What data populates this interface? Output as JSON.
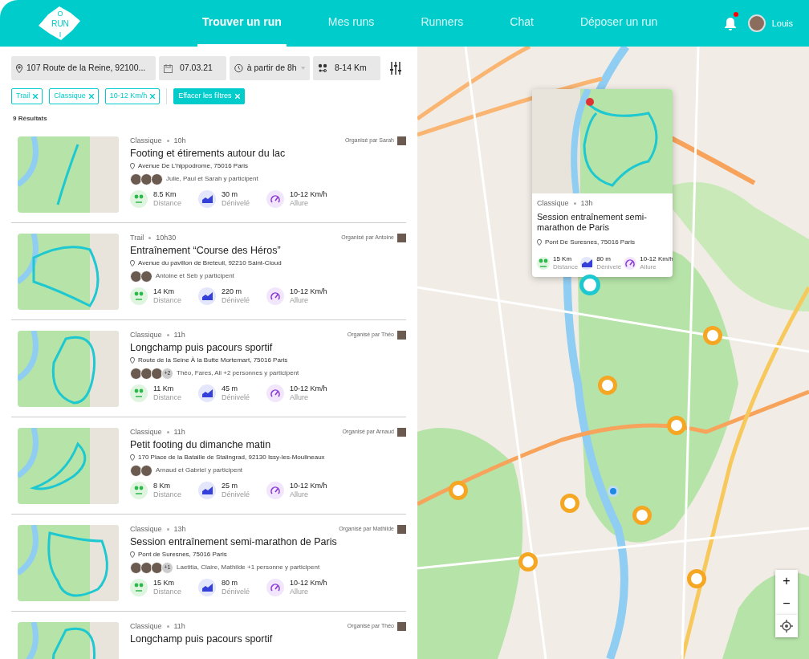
{
  "logo": {
    "top": "O",
    "middle": "RUN",
    "bottom": "I"
  },
  "nav": [
    {
      "label": "Trouver un run",
      "selected": true
    },
    {
      "label": "Mes runs",
      "selected": false
    },
    {
      "label": "Runners",
      "selected": false
    },
    {
      "label": "Chat",
      "selected": false
    },
    {
      "label": "Déposer un run",
      "selected": false
    }
  ],
  "notifications": {
    "unread": true
  },
  "user": {
    "name": "Louis"
  },
  "filters": {
    "location": "107 Route de la Reine, 92100...",
    "date": "07.03.21",
    "time": "à partir de 8h",
    "distance": "8-14 Km"
  },
  "chips": [
    {
      "label": "Trail"
    },
    {
      "label": "Classique"
    },
    {
      "label": "10-12 Km/h"
    }
  ],
  "clear_filters": "Effacer les filtres",
  "results_count": "9 Résultats",
  "runs": [
    {
      "type": "Classique",
      "time": "10h",
      "title": "Footing et étirements autour du lac",
      "organizer": "Organisé par Sarah",
      "address": "Avenue De L'hippodrome, 75016 Paris",
      "avatars": [
        {
          "kind": "photo"
        },
        {
          "kind": "photo"
        },
        {
          "kind": "photo"
        }
      ],
      "participants": "Julie, Paul et Sarah y participent",
      "stats": [
        {
          "kind": "distance",
          "value": "8.5 Km",
          "label": "Distance"
        },
        {
          "kind": "elevation",
          "value": "30 m",
          "label": "Dénivelé"
        },
        {
          "kind": "pace",
          "value": "10-12 Km/h",
          "label": "Allure"
        }
      ]
    },
    {
      "type": "Trail",
      "time": "10h30",
      "title": "Entraînement “Course des Héros”",
      "organizer": "Organisé par Antoine",
      "address": "Avenue du pavillon de Breteuil, 92210 Saint-Cloud",
      "avatars": [
        {
          "kind": "photo"
        },
        {
          "kind": "photo"
        }
      ],
      "participants": "Antoine et Seb y participent",
      "stats": [
        {
          "kind": "distance",
          "value": "14 Km",
          "label": "Distance"
        },
        {
          "kind": "elevation",
          "value": "220 m",
          "label": "Dénivelé"
        },
        {
          "kind": "pace",
          "value": "10-12 Km/h",
          "label": "Allure"
        }
      ]
    },
    {
      "type": "Classique",
      "time": "11h",
      "title": "Longchamp puis pacours sportif",
      "organizer": "Organisé par Théo",
      "address": "Route de la Seine À la Butte Mortemart, 75016 Paris",
      "avatars": [
        {
          "kind": "photo"
        },
        {
          "kind": "photo"
        },
        {
          "kind": "photo"
        },
        {
          "kind": "more",
          "label": "+2"
        }
      ],
      "participants": "Théo, Fares, Ali +2 personnes y participent",
      "stats": [
        {
          "kind": "distance",
          "value": "11 Km",
          "label": "Distance"
        },
        {
          "kind": "elevation",
          "value": "45 m",
          "label": "Dénivelé"
        },
        {
          "kind": "pace",
          "value": "10-12 Km/h",
          "label": "Allure"
        }
      ]
    },
    {
      "type": "Classique",
      "time": "11h",
      "title": "Petit footing du dimanche matin",
      "organizer": "Organisé par Arnaud",
      "address": "170 Place de la Bataille de Stalingrad, 92130 Issy-les-Moulineaux",
      "avatars": [
        {
          "kind": "photo"
        },
        {
          "kind": "photo"
        }
      ],
      "participants": "Arnaud et Gabriel y participent",
      "stats": [
        {
          "kind": "distance",
          "value": "8 Km",
          "label": "Distance"
        },
        {
          "kind": "elevation",
          "value": "25 m",
          "label": "Dénivelé"
        },
        {
          "kind": "pace",
          "value": "10-12 Km/h",
          "label": "Allure"
        }
      ]
    },
    {
      "type": "Classique",
      "time": "13h",
      "title": "Session entraînement semi-marathon de Paris",
      "organizer": "Organisé par Mathilde",
      "address": "Pont de Suresnes, 75016 Paris",
      "avatars": [
        {
          "kind": "photo"
        },
        {
          "kind": "photo"
        },
        {
          "kind": "photo"
        },
        {
          "kind": "more",
          "label": "+1"
        }
      ],
      "participants": "Laetitia, Claire, Mathilde +1 personne y participent",
      "stats": [
        {
          "kind": "distance",
          "value": "15 Km",
          "label": "Distance"
        },
        {
          "kind": "elevation",
          "value": "80 m",
          "label": "Dénivelé"
        },
        {
          "kind": "pace",
          "value": "10-12 Km/h",
          "label": "Allure"
        }
      ]
    },
    {
      "type": "Classique",
      "time": "11h",
      "title": "Longchamp puis pacours sportif",
      "organizer": "Organisé par Théo"
    }
  ],
  "popup": {
    "type": "Classique",
    "time": "13h",
    "title": "Session entraînement semi-marathon de Paris",
    "address": "Pont De Suresnes, 75016 Paris",
    "stats": [
      {
        "kind": "distance",
        "value": "15 Km",
        "label": "Distance"
      },
      {
        "kind": "elevation",
        "value": "80 m",
        "label": "Dénivelé"
      },
      {
        "kind": "pace",
        "value": "10-12 Km/h",
        "label": "Allure"
      }
    ]
  },
  "markers": [
    {
      "selected": true
    },
    {
      "selected": false
    },
    {
      "selected": false
    },
    {
      "selected": false
    },
    {
      "selected": false
    },
    {
      "selected": false
    },
    {
      "selected": false
    },
    {
      "selected": false
    },
    {
      "selected": false
    }
  ],
  "zoom": {
    "in": "+",
    "out": "−"
  }
}
